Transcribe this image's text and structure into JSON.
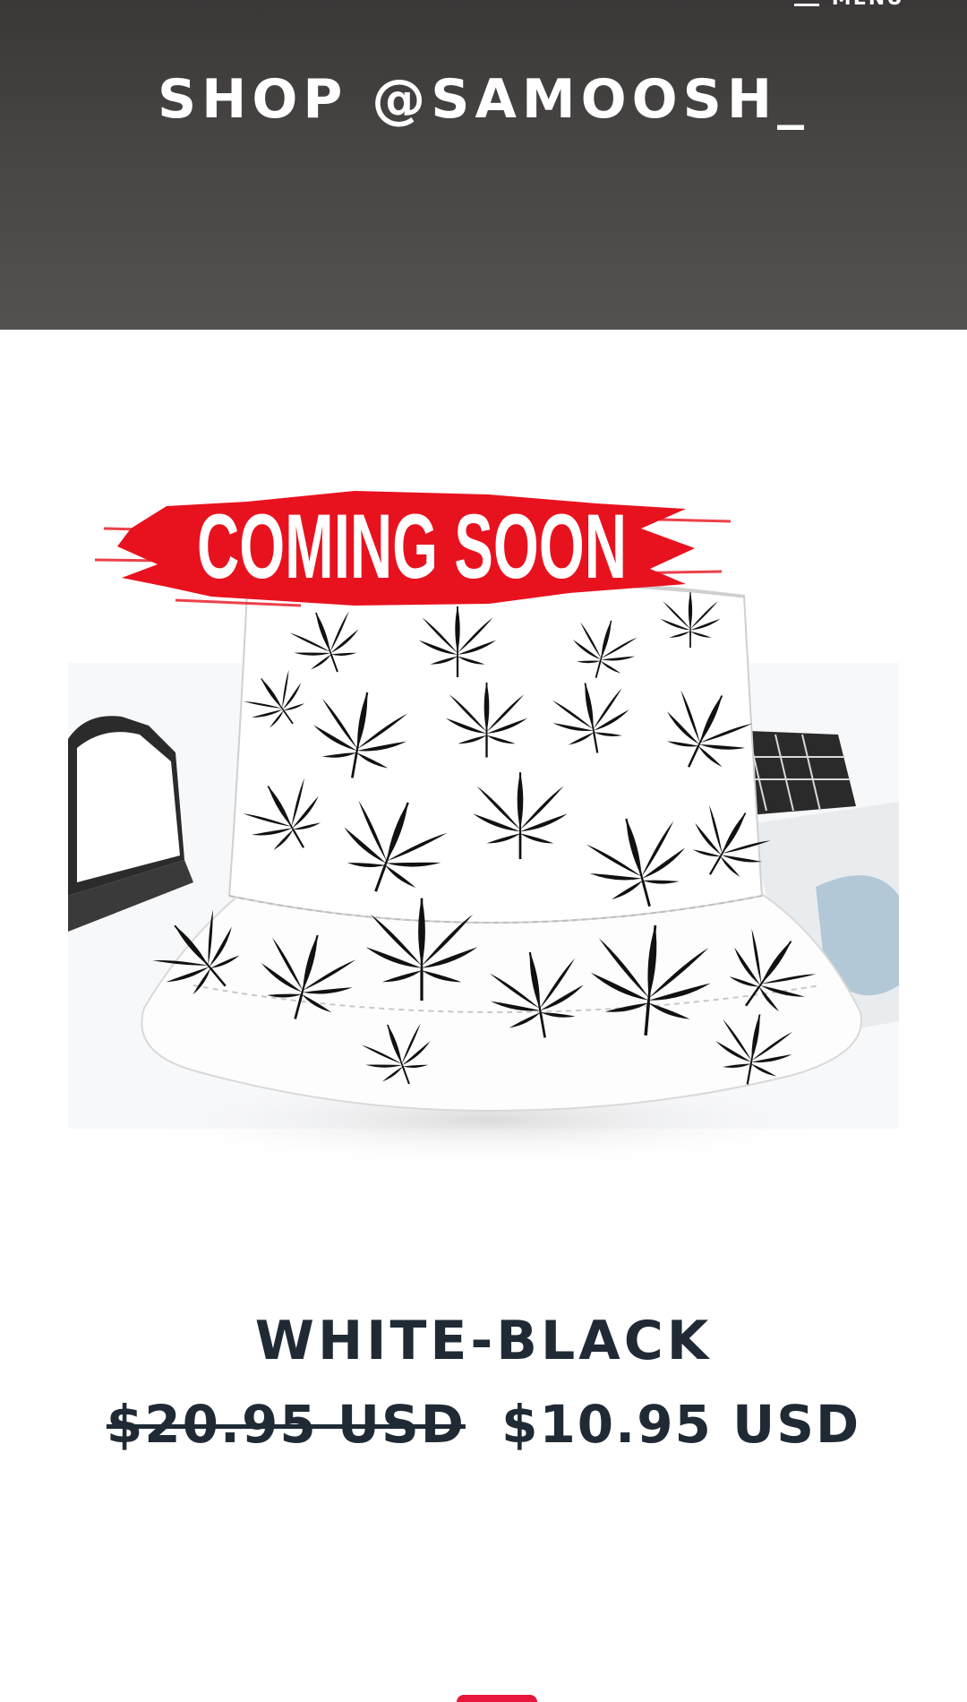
{
  "header": {
    "site_title": "SHOP @SAMOOSH_",
    "menu_label": "MENU",
    "menu_icon": "hamburger-icon"
  },
  "product": {
    "image_alt": "Bucket hat with leaf print",
    "badge_text": "COMING SOON",
    "title": "WHITE-BLACK",
    "price_original": "$20.95 USD",
    "price_sale": "$10.95 USD"
  },
  "colors": {
    "header_bg": "#44413f",
    "text_dark": "#1f2a35",
    "badge_red": "#e8121e"
  }
}
